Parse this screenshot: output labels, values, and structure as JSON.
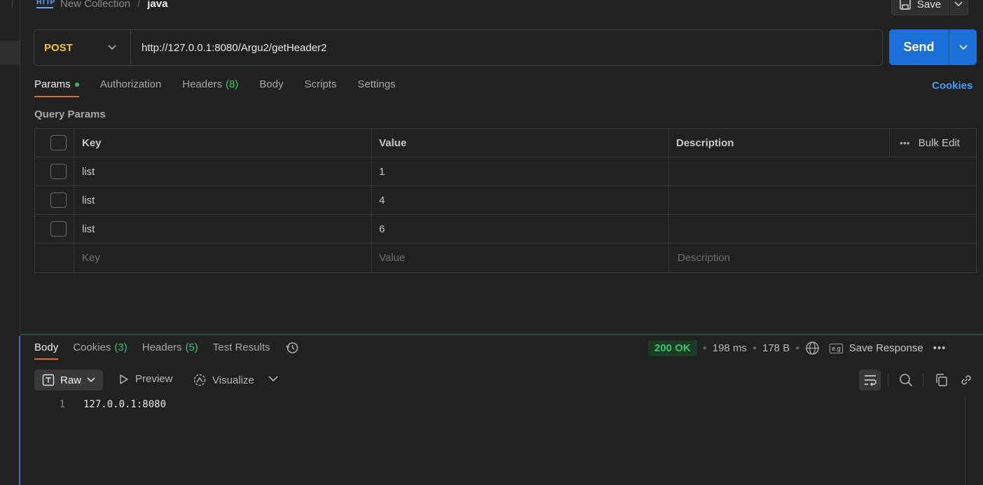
{
  "breadcrumb": {
    "icon_label": "HTTP",
    "parent": "New Collection",
    "separator": "/",
    "current": "java"
  },
  "toolbar": {
    "save_label": "Save"
  },
  "request": {
    "method": "POST",
    "url": "http://127.0.0.1:8080/Argu2/getHeader2",
    "send_label": "Send"
  },
  "request_tabs": [
    {
      "label": "Params",
      "active": true,
      "dot": true
    },
    {
      "label": "Authorization"
    },
    {
      "label": "Headers",
      "count": "(8)"
    },
    {
      "label": "Body"
    },
    {
      "label": "Scripts"
    },
    {
      "label": "Settings"
    }
  ],
  "cookies_link": "Cookies",
  "query_params": {
    "title": "Query Params",
    "headers": {
      "key": "Key",
      "value": "Value",
      "description": "Description",
      "bulk_edit": "Bulk Edit"
    },
    "rows": [
      {
        "key": "list",
        "value": "1",
        "description": ""
      },
      {
        "key": "list",
        "value": "4",
        "description": ""
      },
      {
        "key": "list",
        "value": "6",
        "description": ""
      }
    ],
    "placeholders": {
      "key": "Key",
      "value": "Value",
      "description": "Description"
    }
  },
  "response_tabs": [
    {
      "label": "Body",
      "active": true
    },
    {
      "label": "Cookies",
      "count": "(3)"
    },
    {
      "label": "Headers",
      "count": "(5)"
    },
    {
      "label": "Test Results"
    }
  ],
  "response_status": {
    "status": "200 OK",
    "time": "198 ms",
    "size": "178 B",
    "save_response": "Save Response",
    "eg_label": "e.g"
  },
  "response_view": {
    "format": "Raw",
    "preview": "Preview",
    "visualize": "Visualize"
  },
  "response_body": {
    "lines": [
      {
        "number": "1",
        "text": "127.0.0.1:8080"
      }
    ]
  },
  "colors": {
    "accent_orange": "#e06a3a",
    "send_blue": "#1c6fd8",
    "method_yellow": "#f4c53c",
    "status_green": "#3cc46b",
    "link_blue": "#4d9cf5"
  }
}
